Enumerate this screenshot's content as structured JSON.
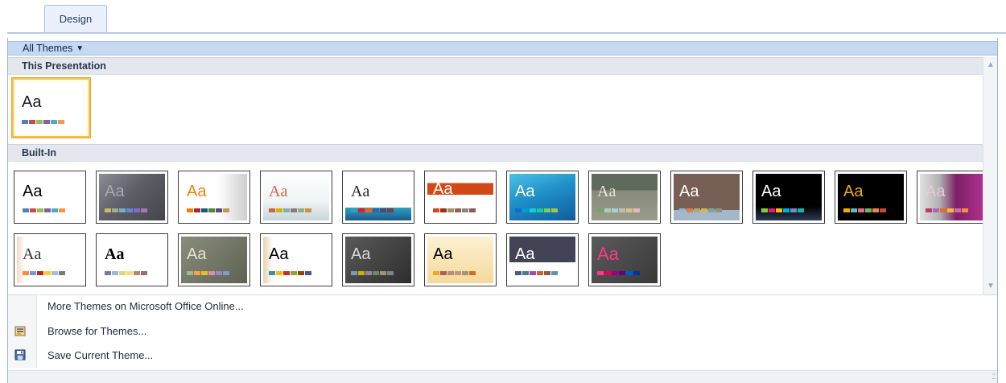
{
  "ribbon": {
    "tab_label": "Design"
  },
  "gallery": {
    "filter_label": "All Themes",
    "section_this": "This Presentation",
    "section_builtin": "Built-In",
    "thumb_text": "Aa"
  },
  "menu": {
    "more_themes": "More Themes on Microsoft Office Online...",
    "browse_themes": "Browse for Themes...",
    "save_theme": "Save Current Theme..."
  },
  "icons": {
    "filter_caret": "dropdown-caret-icon",
    "scroll_up": "scroll-up-arrow-icon",
    "scroll_down": "scroll-down-arrow-icon",
    "browse": "folder-themes-icon",
    "save": "save-theme-icon",
    "resize": "resize-grip-icon"
  },
  "colors": {
    "accent_blue": "#c5d9f3",
    "selection_gold": "#f2c152",
    "section_gray": "#e4e8ee"
  }
}
